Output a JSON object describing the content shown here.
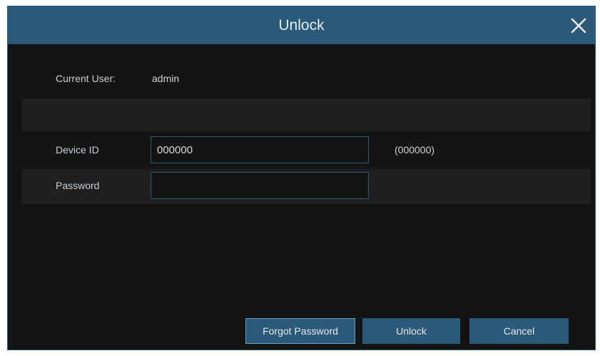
{
  "dialog": {
    "title": "Unlock",
    "close_icon": "close-x-icon"
  },
  "current_user": {
    "label": "Current User:",
    "value": "admin"
  },
  "device_id": {
    "label": "Device ID",
    "value": "000000",
    "hint": "(000000)"
  },
  "password": {
    "label": "Password",
    "value": ""
  },
  "buttons": {
    "forgot_password": "Forgot Password",
    "unlock": "Unlock",
    "cancel": "Cancel"
  },
  "colors": {
    "accent": "#2b5a78",
    "background": "#141414",
    "row_shade": "#1f1f1f"
  }
}
